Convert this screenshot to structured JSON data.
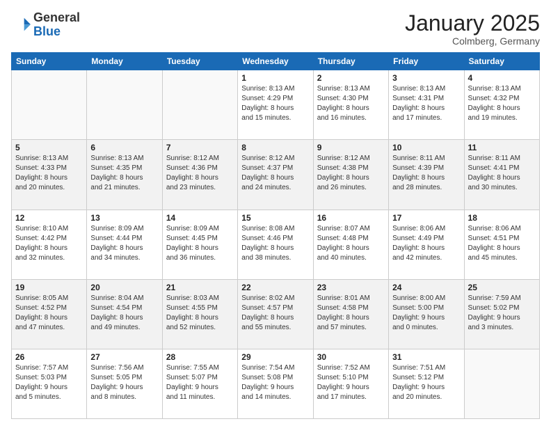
{
  "logo": {
    "general": "General",
    "blue": "Blue"
  },
  "header": {
    "month": "January 2025",
    "location": "Colmberg, Germany"
  },
  "weekdays": [
    "Sunday",
    "Monday",
    "Tuesday",
    "Wednesday",
    "Thursday",
    "Friday",
    "Saturday"
  ],
  "weeks": [
    [
      {
        "day": "",
        "info": ""
      },
      {
        "day": "",
        "info": ""
      },
      {
        "day": "",
        "info": ""
      },
      {
        "day": "1",
        "info": "Sunrise: 8:13 AM\nSunset: 4:29 PM\nDaylight: 8 hours\nand 15 minutes."
      },
      {
        "day": "2",
        "info": "Sunrise: 8:13 AM\nSunset: 4:30 PM\nDaylight: 8 hours\nand 16 minutes."
      },
      {
        "day": "3",
        "info": "Sunrise: 8:13 AM\nSunset: 4:31 PM\nDaylight: 8 hours\nand 17 minutes."
      },
      {
        "day": "4",
        "info": "Sunrise: 8:13 AM\nSunset: 4:32 PM\nDaylight: 8 hours\nand 19 minutes."
      }
    ],
    [
      {
        "day": "5",
        "info": "Sunrise: 8:13 AM\nSunset: 4:33 PM\nDaylight: 8 hours\nand 20 minutes."
      },
      {
        "day": "6",
        "info": "Sunrise: 8:13 AM\nSunset: 4:35 PM\nDaylight: 8 hours\nand 21 minutes."
      },
      {
        "day": "7",
        "info": "Sunrise: 8:12 AM\nSunset: 4:36 PM\nDaylight: 8 hours\nand 23 minutes."
      },
      {
        "day": "8",
        "info": "Sunrise: 8:12 AM\nSunset: 4:37 PM\nDaylight: 8 hours\nand 24 minutes."
      },
      {
        "day": "9",
        "info": "Sunrise: 8:12 AM\nSunset: 4:38 PM\nDaylight: 8 hours\nand 26 minutes."
      },
      {
        "day": "10",
        "info": "Sunrise: 8:11 AM\nSunset: 4:39 PM\nDaylight: 8 hours\nand 28 minutes."
      },
      {
        "day": "11",
        "info": "Sunrise: 8:11 AM\nSunset: 4:41 PM\nDaylight: 8 hours\nand 30 minutes."
      }
    ],
    [
      {
        "day": "12",
        "info": "Sunrise: 8:10 AM\nSunset: 4:42 PM\nDaylight: 8 hours\nand 32 minutes."
      },
      {
        "day": "13",
        "info": "Sunrise: 8:09 AM\nSunset: 4:44 PM\nDaylight: 8 hours\nand 34 minutes."
      },
      {
        "day": "14",
        "info": "Sunrise: 8:09 AM\nSunset: 4:45 PM\nDaylight: 8 hours\nand 36 minutes."
      },
      {
        "day": "15",
        "info": "Sunrise: 8:08 AM\nSunset: 4:46 PM\nDaylight: 8 hours\nand 38 minutes."
      },
      {
        "day": "16",
        "info": "Sunrise: 8:07 AM\nSunset: 4:48 PM\nDaylight: 8 hours\nand 40 minutes."
      },
      {
        "day": "17",
        "info": "Sunrise: 8:06 AM\nSunset: 4:49 PM\nDaylight: 8 hours\nand 42 minutes."
      },
      {
        "day": "18",
        "info": "Sunrise: 8:06 AM\nSunset: 4:51 PM\nDaylight: 8 hours\nand 45 minutes."
      }
    ],
    [
      {
        "day": "19",
        "info": "Sunrise: 8:05 AM\nSunset: 4:52 PM\nDaylight: 8 hours\nand 47 minutes."
      },
      {
        "day": "20",
        "info": "Sunrise: 8:04 AM\nSunset: 4:54 PM\nDaylight: 8 hours\nand 49 minutes."
      },
      {
        "day": "21",
        "info": "Sunrise: 8:03 AM\nSunset: 4:55 PM\nDaylight: 8 hours\nand 52 minutes."
      },
      {
        "day": "22",
        "info": "Sunrise: 8:02 AM\nSunset: 4:57 PM\nDaylight: 8 hours\nand 55 minutes."
      },
      {
        "day": "23",
        "info": "Sunrise: 8:01 AM\nSunset: 4:58 PM\nDaylight: 8 hours\nand 57 minutes."
      },
      {
        "day": "24",
        "info": "Sunrise: 8:00 AM\nSunset: 5:00 PM\nDaylight: 9 hours\nand 0 minutes."
      },
      {
        "day": "25",
        "info": "Sunrise: 7:59 AM\nSunset: 5:02 PM\nDaylight: 9 hours\nand 3 minutes."
      }
    ],
    [
      {
        "day": "26",
        "info": "Sunrise: 7:57 AM\nSunset: 5:03 PM\nDaylight: 9 hours\nand 5 minutes."
      },
      {
        "day": "27",
        "info": "Sunrise: 7:56 AM\nSunset: 5:05 PM\nDaylight: 9 hours\nand 8 minutes."
      },
      {
        "day": "28",
        "info": "Sunrise: 7:55 AM\nSunset: 5:07 PM\nDaylight: 9 hours\nand 11 minutes."
      },
      {
        "day": "29",
        "info": "Sunrise: 7:54 AM\nSunset: 5:08 PM\nDaylight: 9 hours\nand 14 minutes."
      },
      {
        "day": "30",
        "info": "Sunrise: 7:52 AM\nSunset: 5:10 PM\nDaylight: 9 hours\nand 17 minutes."
      },
      {
        "day": "31",
        "info": "Sunrise: 7:51 AM\nSunset: 5:12 PM\nDaylight: 9 hours\nand 20 minutes."
      },
      {
        "day": "",
        "info": ""
      }
    ]
  ]
}
